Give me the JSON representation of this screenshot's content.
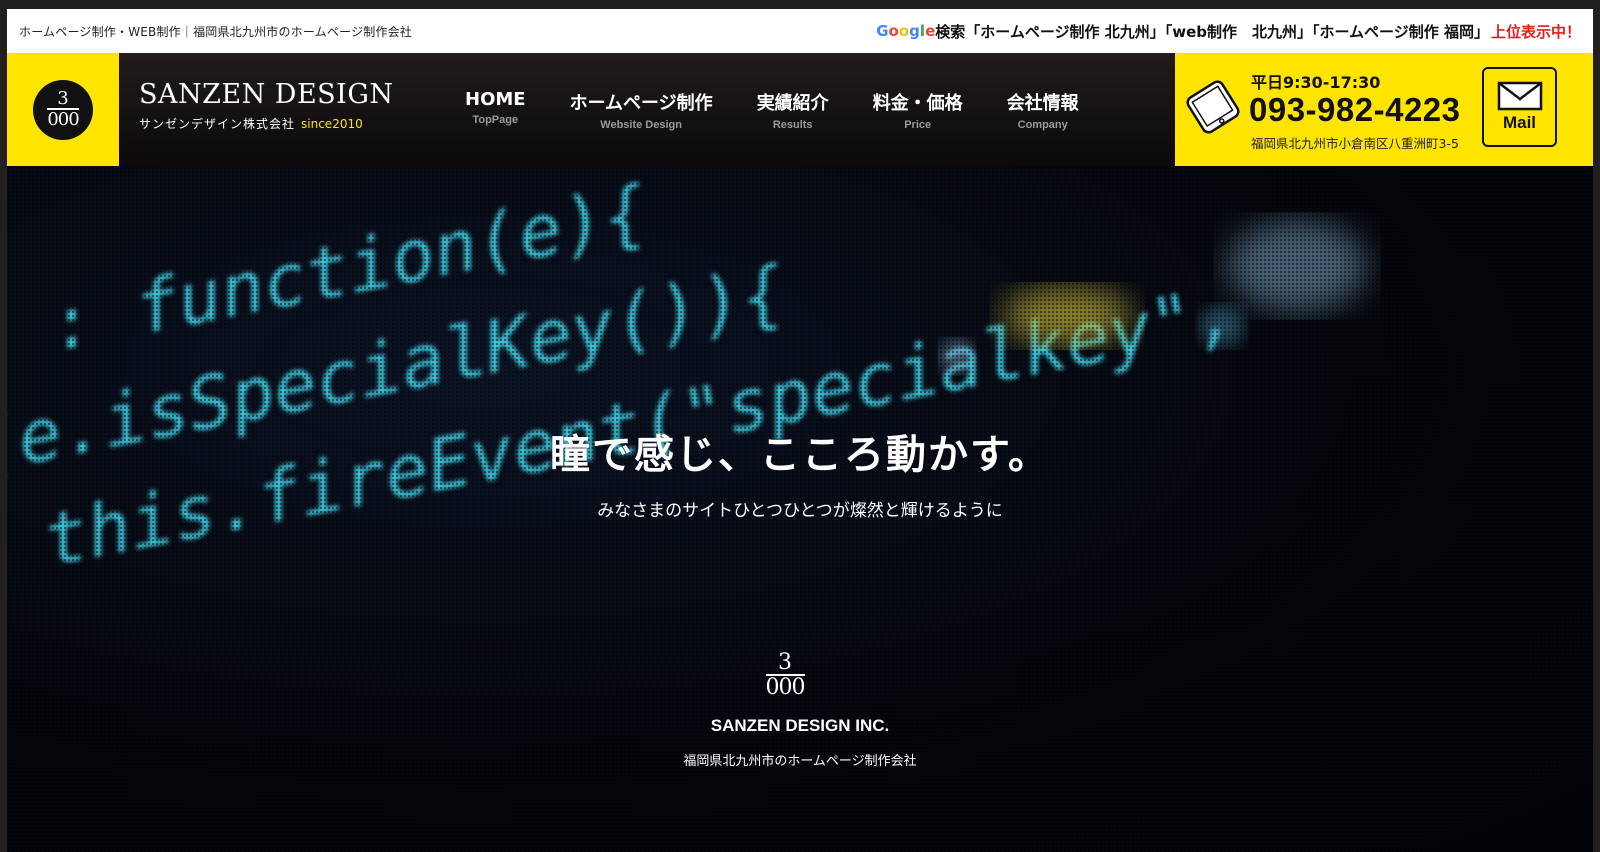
{
  "topbar": {
    "left_text": "ホームページ制作・WEB制作｜福岡県北九州市のホームページ制作会社",
    "google_letters": [
      {
        "char": "G",
        "color": "#4285F4"
      },
      {
        "char": "o",
        "color": "#EA4335"
      },
      {
        "char": "o",
        "color": "#FBBC05"
      },
      {
        "char": "g",
        "color": "#4285F4"
      },
      {
        "char": "l",
        "color": "#34A853"
      },
      {
        "char": "e",
        "color": "#EA4335"
      }
    ],
    "search_text": "検索「ホームページ制作 北九州」「web制作　北九州」「ホームページ制作 福岡」",
    "highlight_text": "上位表示中！"
  },
  "logo": {
    "top_digit": "3",
    "bottom_digits": "000"
  },
  "brand": {
    "name": "SANZEN DESIGN",
    "sub": "サンゼンデザイン株式会社",
    "since": "since2010"
  },
  "nav": [
    {
      "label": "HOME",
      "sub": "TopPage"
    },
    {
      "label": "ホームページ制作",
      "sub": "Website Design"
    },
    {
      "label": "実績紹介",
      "sub": "Results"
    },
    {
      "label": "料金・価格",
      "sub": "Price"
    },
    {
      "label": "会社情報",
      "sub": "Company"
    }
  ],
  "contact": {
    "hours": "平日9:30-17:30",
    "phone": "093-982-4223",
    "address": "福岡県北九州市小倉南区八重洲町3-5",
    "mail_label": "Mail"
  },
  "hero": {
    "code_lines": [
      {
        "text": "y : function(e){",
        "color": "#3fc8de"
      },
      {
        "text": "(e.isSpecialKey()){",
        "color": "#3fc8de"
      },
      {
        "text": "this.fireEvent(\"specialkey\",",
        "color": "#3fc8de"
      }
    ],
    "title": "瞳で感じ、こころ動かす。",
    "subtitle": "みなさまのサイトひとつひとつが燦然と輝けるように",
    "company_mark_top": "3",
    "company_mark_bottom": "000",
    "company_name": "SANZEN DESIGN INC.",
    "company_desc": "福岡県北九州市のホームページ制作会社"
  },
  "colors": {
    "accent_yellow": "#ffe400",
    "highlight_red": "#e0201e",
    "header_dark": "#1a1515"
  }
}
